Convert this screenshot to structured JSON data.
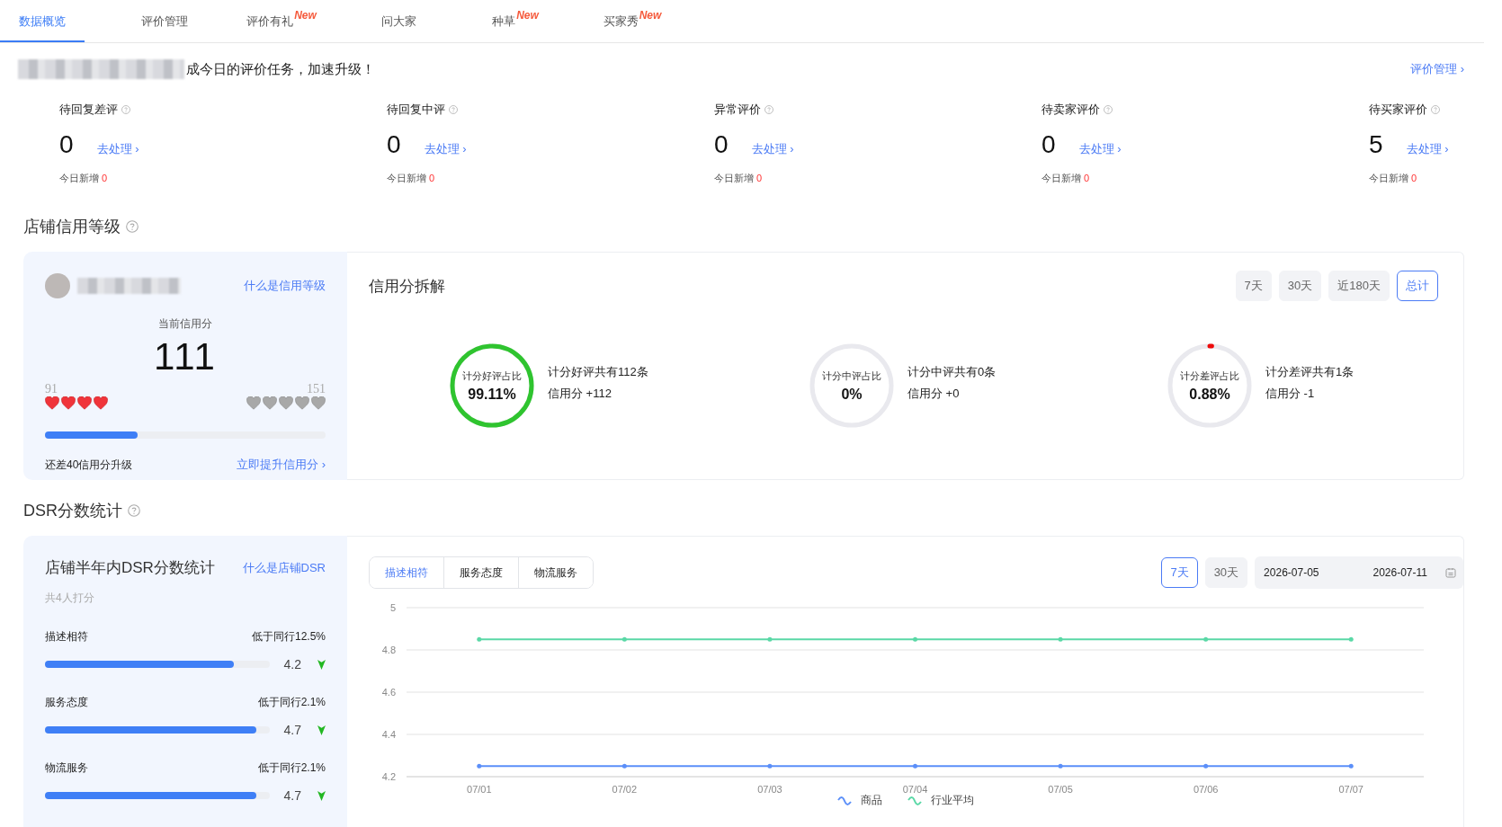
{
  "tabs": [
    {
      "label": "数据概览",
      "selected": true
    },
    {
      "label": "评价管理",
      "selected": false
    },
    {
      "label": "评价有礼",
      "badge": "New",
      "selected": false
    },
    {
      "label": "问大家",
      "selected": false
    },
    {
      "label": "种草",
      "badge": "New",
      "selected": false
    },
    {
      "label": "买家秀",
      "badge": "New",
      "selected": false
    }
  ],
  "notice": "成今日的评价任务，加速升级！",
  "review_link": "评价管理 ›",
  "stats": [
    {
      "label": "待回复差评",
      "value": "0",
      "action": "去处理 ›",
      "today_label": "今日新增",
      "today_value": "0"
    },
    {
      "label": "待回复中评",
      "value": "0",
      "action": "去处理 ›",
      "today_label": "今日新增",
      "today_value": "0"
    },
    {
      "label": "异常评价",
      "value": "0",
      "action": "去处理 ›",
      "today_label": "今日新增",
      "today_value": "0"
    },
    {
      "label": "待卖家评价",
      "value": "0",
      "action": "去处理 ›",
      "today_label": "今日新增",
      "today_value": "0"
    },
    {
      "label": "待买家评价",
      "value": "5",
      "action": "去处理 ›",
      "today_label": "今日新增",
      "today_value": "0"
    }
  ],
  "credit": {
    "title": "店铺信用等级",
    "what_link": "什么是信用等级",
    "score_label": "当前信用分",
    "score": "111",
    "low": {
      "label": "91",
      "stars": 4
    },
    "high": {
      "label": "151",
      "stars": 0
    },
    "level": 0.33,
    "gap_text": "还差40信用分升级",
    "boost_link": "立即提升信用分 ›"
  },
  "breakdown": {
    "title": "信用分拆解",
    "ranges": [
      {
        "label": "7天",
        "selected": false
      },
      {
        "label": "30天",
        "selected": false
      },
      {
        "label": "近180天",
        "selected": false
      },
      {
        "label": "总计",
        "selected": true
      }
    ],
    "items": [
      {
        "ring_label": "计分好评占比",
        "percent": "99.11%",
        "level": 0.9911,
        "color": "#2fc42f",
        "count_text": "计分好评共有112条",
        "score_text": "信用分 +112"
      },
      {
        "ring_label": "计分中评占比",
        "percent": "0%",
        "count_text": "计分中评共有0条",
        "score_text": "信用分 +0"
      },
      {
        "ring_label": "计分差评占比",
        "percent": "0.88%",
        "level": 0.0088,
        "color": "#ee0a0a",
        "count_text": "计分差评共有1条",
        "score_text": "信用分 -1"
      }
    ]
  },
  "dsr": {
    "title": "DSR分数统计",
    "card_title": "店铺半年内DSR分数统计",
    "what_link": "什么是店铺DSR",
    "raters": "共4人打分",
    "items": [
      {
        "name": "描述相符",
        "compare": "低于同行12.5%",
        "score": "4.2",
        "level": 0.84,
        "falling": true
      },
      {
        "name": "服务态度",
        "compare": "低于同行2.1%",
        "score": "4.7",
        "level": 0.94,
        "falling": true
      },
      {
        "name": "物流服务",
        "compare": "低于同行2.1%",
        "score": "4.7",
        "level": 0.94,
        "falling": true
      }
    ],
    "tabs": [
      {
        "label": "描述相符",
        "selected": true
      },
      {
        "label": "服务态度",
        "selected": false
      },
      {
        "label": "物流服务",
        "selected": false
      }
    ],
    "ranges": [
      {
        "label": "7天",
        "selected": true
      },
      {
        "label": "30天",
        "selected": false
      }
    ],
    "date_start": "2026-07-05",
    "date_end": "2026-07-11",
    "chart_data": {
      "type": "line",
      "categories": [
        "07/01",
        "07/02",
        "07/03",
        "07/04",
        "07/05",
        "07/06",
        "07/07"
      ],
      "ylim": [
        4.2,
        5
      ],
      "yticks": [
        4.2,
        4.4,
        4.6,
        4.8,
        5
      ],
      "grid": true,
      "legend": "bottom",
      "series": [
        {
          "name": "商品",
          "color": "#5b8ff9",
          "values": [
            4.25,
            4.25,
            4.25,
            4.25,
            4.25,
            4.25,
            4.25
          ]
        },
        {
          "name": "行业平均",
          "color": "#5ad8a6",
          "values": [
            4.85,
            4.85,
            4.85,
            4.85,
            4.85,
            4.85,
            4.85
          ]
        }
      ]
    }
  }
}
